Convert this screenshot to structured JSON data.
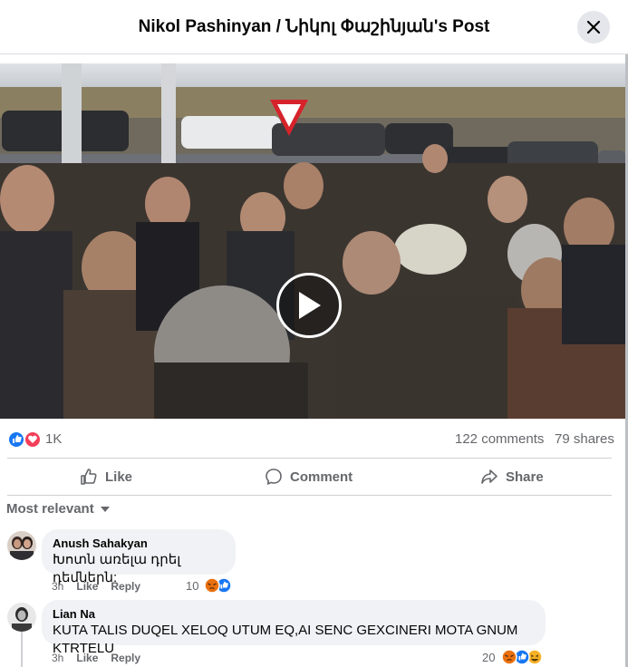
{
  "header": {
    "title": "Nikol Pashinyan / Նիկոլ Փաշինյան's Post",
    "close_icon": "close-icon"
  },
  "video": {
    "play_icon": "play-icon"
  },
  "stats": {
    "reactions": [
      "like-icon",
      "love-icon"
    ],
    "reaction_count": "1K",
    "comments": "122 comments",
    "shares": "79 shares"
  },
  "actions": {
    "like": "Like",
    "comment": "Comment",
    "share": "Share"
  },
  "sort_label": "Most relevant",
  "comments": [
    {
      "author": "Anush Sahakyan",
      "text": "Խոտն առելա դրել դեմներն:",
      "time": "3h",
      "like": "Like",
      "reply": "Reply",
      "reaction_count": "10",
      "reactions": [
        "angry-icon",
        "like-icon"
      ]
    },
    {
      "author": "Lian Na",
      "text": "KUTA TALIS DUQEL XELOQ UTUM EQ,AI SENC GEXCINERI MOTA GNUM KTRTELU",
      "time": "3h",
      "like": "Like",
      "reply": "Reply",
      "reaction_count": "20",
      "reactions": [
        "angry-icon",
        "like-icon",
        "haha-icon"
      ]
    }
  ],
  "colors": {
    "text": "#050505",
    "secondary": "#65676b",
    "bubble": "#f0f2f5",
    "like_blue": "#1877f2",
    "love_red": "#f33e58",
    "angry_orange": "#e9710f"
  }
}
